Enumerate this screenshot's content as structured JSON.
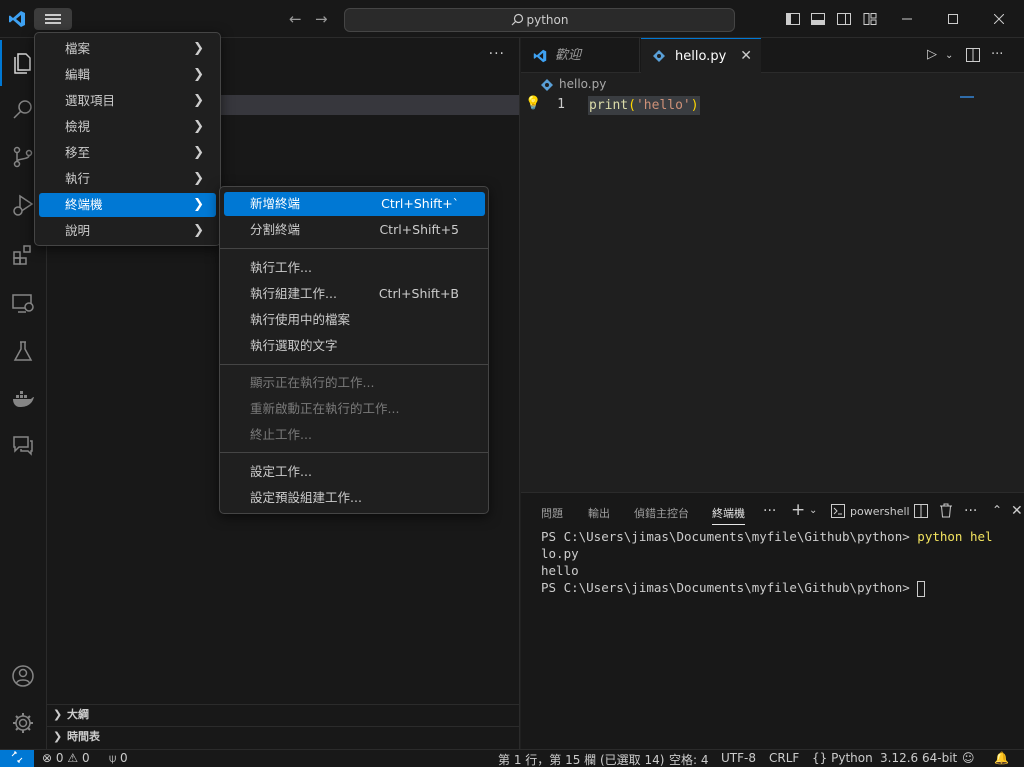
{
  "titlebar": {
    "search_text": "python",
    "back_icon": "←",
    "forward_icon": "→"
  },
  "main_menu": {
    "items": [
      {
        "label": "檔案"
      },
      {
        "label": "編輯"
      },
      {
        "label": "選取項目"
      },
      {
        "label": "檢視"
      },
      {
        "label": "移至"
      },
      {
        "label": "執行"
      },
      {
        "label": "終端機",
        "highlighted": true
      },
      {
        "label": "說明"
      }
    ]
  },
  "terminal_menu": {
    "items": [
      {
        "label": "新增終端",
        "shortcut": "Ctrl+Shift+`",
        "highlighted": true
      },
      {
        "label": "分割終端",
        "shortcut": "Ctrl+Shift+5"
      },
      {
        "label": "執行工作..."
      },
      {
        "label": "執行組建工作...",
        "shortcut": "Ctrl+Shift+B"
      },
      {
        "label": "執行使用中的檔案"
      },
      {
        "label": "執行選取的文字"
      },
      {
        "label": "顯示正在執行的工作...",
        "disabled": true
      },
      {
        "label": "重新啟動正在執行的工作...",
        "disabled": true
      },
      {
        "label": "終止工作...",
        "disabled": true
      },
      {
        "label": "設定工作..."
      },
      {
        "label": "設定預設組建工作..."
      }
    ]
  },
  "sidebar": {
    "panels": [
      {
        "label": "大綱"
      },
      {
        "label": "時間表"
      }
    ]
  },
  "editor": {
    "tabs": [
      {
        "label": "歡迎",
        "active": false
      },
      {
        "label": "hello.py",
        "active": true
      }
    ],
    "breadcrumb": "hello.py",
    "lines": [
      {
        "number": "1",
        "fn": "print",
        "open": "(",
        "str": "'hello'",
        "close": ")"
      }
    ]
  },
  "panel": {
    "tabs": [
      {
        "label": "問題"
      },
      {
        "label": "輸出"
      },
      {
        "label": "偵錯主控台"
      },
      {
        "label": "終端機",
        "active": true
      }
    ],
    "shell_label": "powershell",
    "terminal": {
      "prompt1": "PS C:\\Users\\jimas\\Documents\\myfile\\Github\\python> ",
      "cmd1": "python hel",
      "cmd1_wrap": "lo.py",
      "output": "hello",
      "prompt2": "PS C:\\Users\\jimas\\Documents\\myfile\\Github\\python> "
    }
  },
  "statusbar": {
    "errors": "0",
    "warnings": "0",
    "ports": "0",
    "position": "第 1 行，第 15 欄 (已選取 14)",
    "spaces": "空格: 4",
    "encoding": "UTF-8",
    "eol": "CRLF",
    "language": "Python",
    "interpreter": "3.12.6 64-bit"
  },
  "colors": {
    "accent": "#0078d4",
    "background": "#1f1f1f",
    "chrome": "#181818"
  }
}
